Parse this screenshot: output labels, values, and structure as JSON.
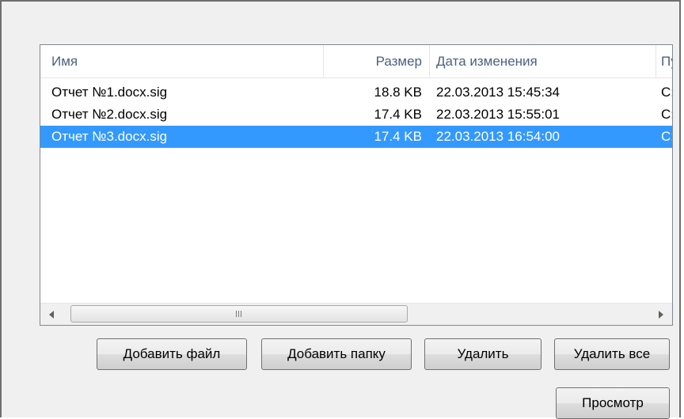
{
  "file_list": {
    "columns": [
      {
        "label": "Имя"
      },
      {
        "label": "Размер"
      },
      {
        "label": "Дата изменения"
      },
      {
        "label": "Путь"
      }
    ],
    "rows": [
      {
        "name": "Отчет №1.docx.sig",
        "size": "18.8 KB",
        "date": "22.03.2013 15:45:34",
        "path": "C:\\Us",
        "selected": false
      },
      {
        "name": "Отчет №2.docx.sig",
        "size": "17.4 KB",
        "date": "22.03.2013 15:55:01",
        "path": "C:\\Us",
        "selected": false
      },
      {
        "name": "Отчет №3.docx.sig",
        "size": "17.4 KB",
        "date": "22.03.2013 16:54:00",
        "path": "C:\\Us",
        "selected": true
      }
    ],
    "selection_color": "#3399ff"
  },
  "buttons": {
    "add_file": "Добавить файл",
    "add_folder": "Добавить папку",
    "delete": "Удалить",
    "delete_all": "Удалить все",
    "preview": "Просмотр"
  },
  "scrollbar": {
    "left_arrow_icon": "chevron-left-icon",
    "right_arrow_icon": "chevron-right-icon",
    "thumb_grip_icon": "grip-icon"
  }
}
